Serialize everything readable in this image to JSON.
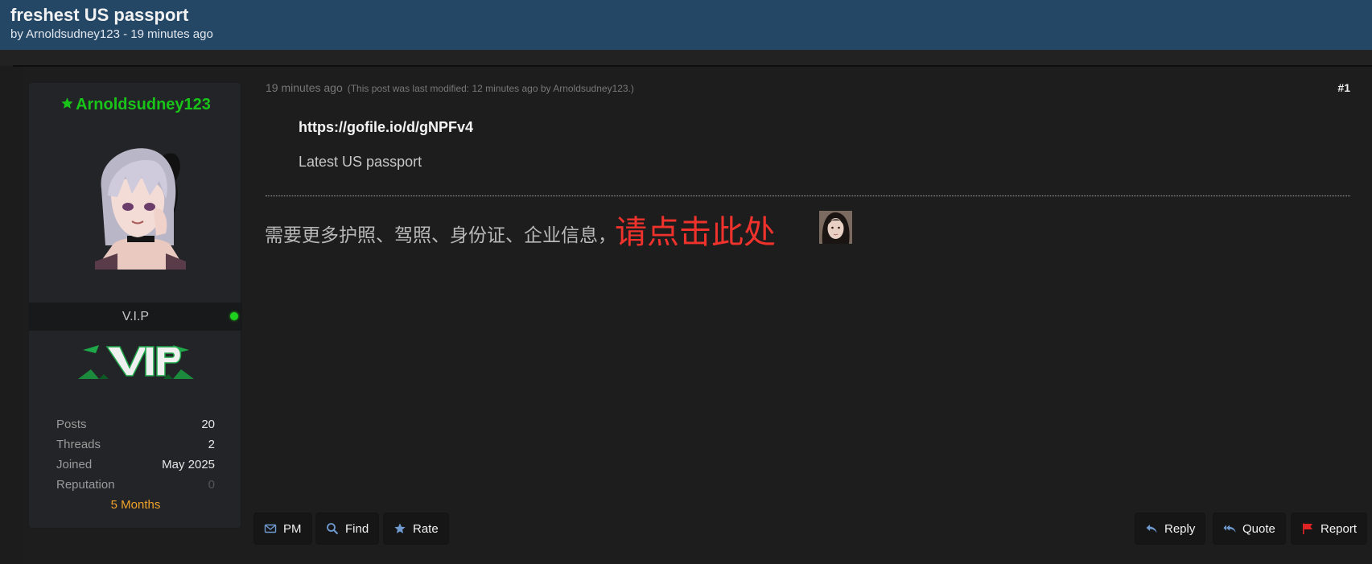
{
  "thread": {
    "title": "freshest US passport",
    "meta": "by Arnoldsudney123 - 19 minutes ago"
  },
  "author": {
    "name": "Arnoldsudney123",
    "rank": "V.I.P",
    "stats": [
      {
        "label": "Posts",
        "value": "20"
      },
      {
        "label": "Threads",
        "value": "2"
      },
      {
        "label": "Joined",
        "value": "May 2025"
      },
      {
        "label": "Reputation",
        "value": "0"
      }
    ],
    "tenure": "5 Months",
    "name_color": "#19c419",
    "online": true
  },
  "post": {
    "time": "19 minutes ago",
    "modified": "(This post was last modified: 12 minutes ago by Arnoldsudney123.)",
    "number": "#1",
    "link": "https://gofile.io/d/gNPFv4",
    "text": "Latest US passport",
    "signature_text": "需要更多护照、驾照、身份证、企业信息，",
    "signature_link": "请点击此处"
  },
  "buttons": {
    "pm": "PM",
    "find": "Find",
    "rate": "Rate",
    "reply": "Reply",
    "quote": "Quote",
    "report": "Report"
  },
  "icons": {
    "pm": "envelope-icon",
    "find": "search-icon",
    "rate": "star-icon",
    "reply": "reply-icon",
    "quote": "quote-reply-icon",
    "report": "flag-icon"
  }
}
